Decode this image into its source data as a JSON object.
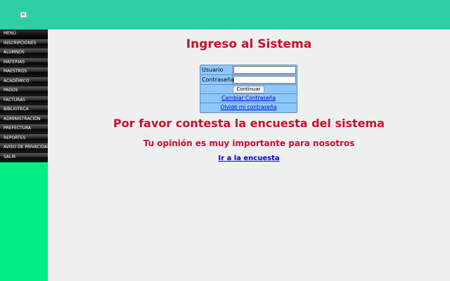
{
  "sidebar": {
    "items": [
      {
        "label": "MENÚ"
      },
      {
        "label": "INSCRIPCIONES"
      },
      {
        "label": "ALUMNOS"
      },
      {
        "label": "MATERIAS"
      },
      {
        "label": "MAESTROS"
      },
      {
        "label": "ACADÉMICO"
      },
      {
        "label": "PAGOS"
      },
      {
        "label": "FACTURAS"
      },
      {
        "label": "BIBLIOTECA"
      },
      {
        "label": "ADMINISTRACIÓN"
      },
      {
        "label": "PREFECTURA"
      },
      {
        "label": "REPORTES"
      },
      {
        "label": "AVISO DE PRIVACIDAD"
      },
      {
        "label": "SALIR"
      }
    ]
  },
  "main": {
    "title": "Ingreso al Sistema",
    "login": {
      "user_label": "Usuario",
      "user_value": "",
      "password_label": "Contraseña",
      "password_value": "",
      "submit_label": "Continuar",
      "change_password": "Cambiar Contraseña",
      "forgot_password": "Olvidé mi contraseña"
    },
    "survey_heading": "Por favor contesta la encuesta del sistema",
    "survey_subheading": "Tu opinión es muy importante para nosotros",
    "survey_link": "Ir a la encuesta"
  },
  "colors": {
    "header": "#2ecfa4",
    "sidebar": "#00ee82",
    "heading_red": "#c8102e",
    "login_box": "#8cc8ff"
  }
}
